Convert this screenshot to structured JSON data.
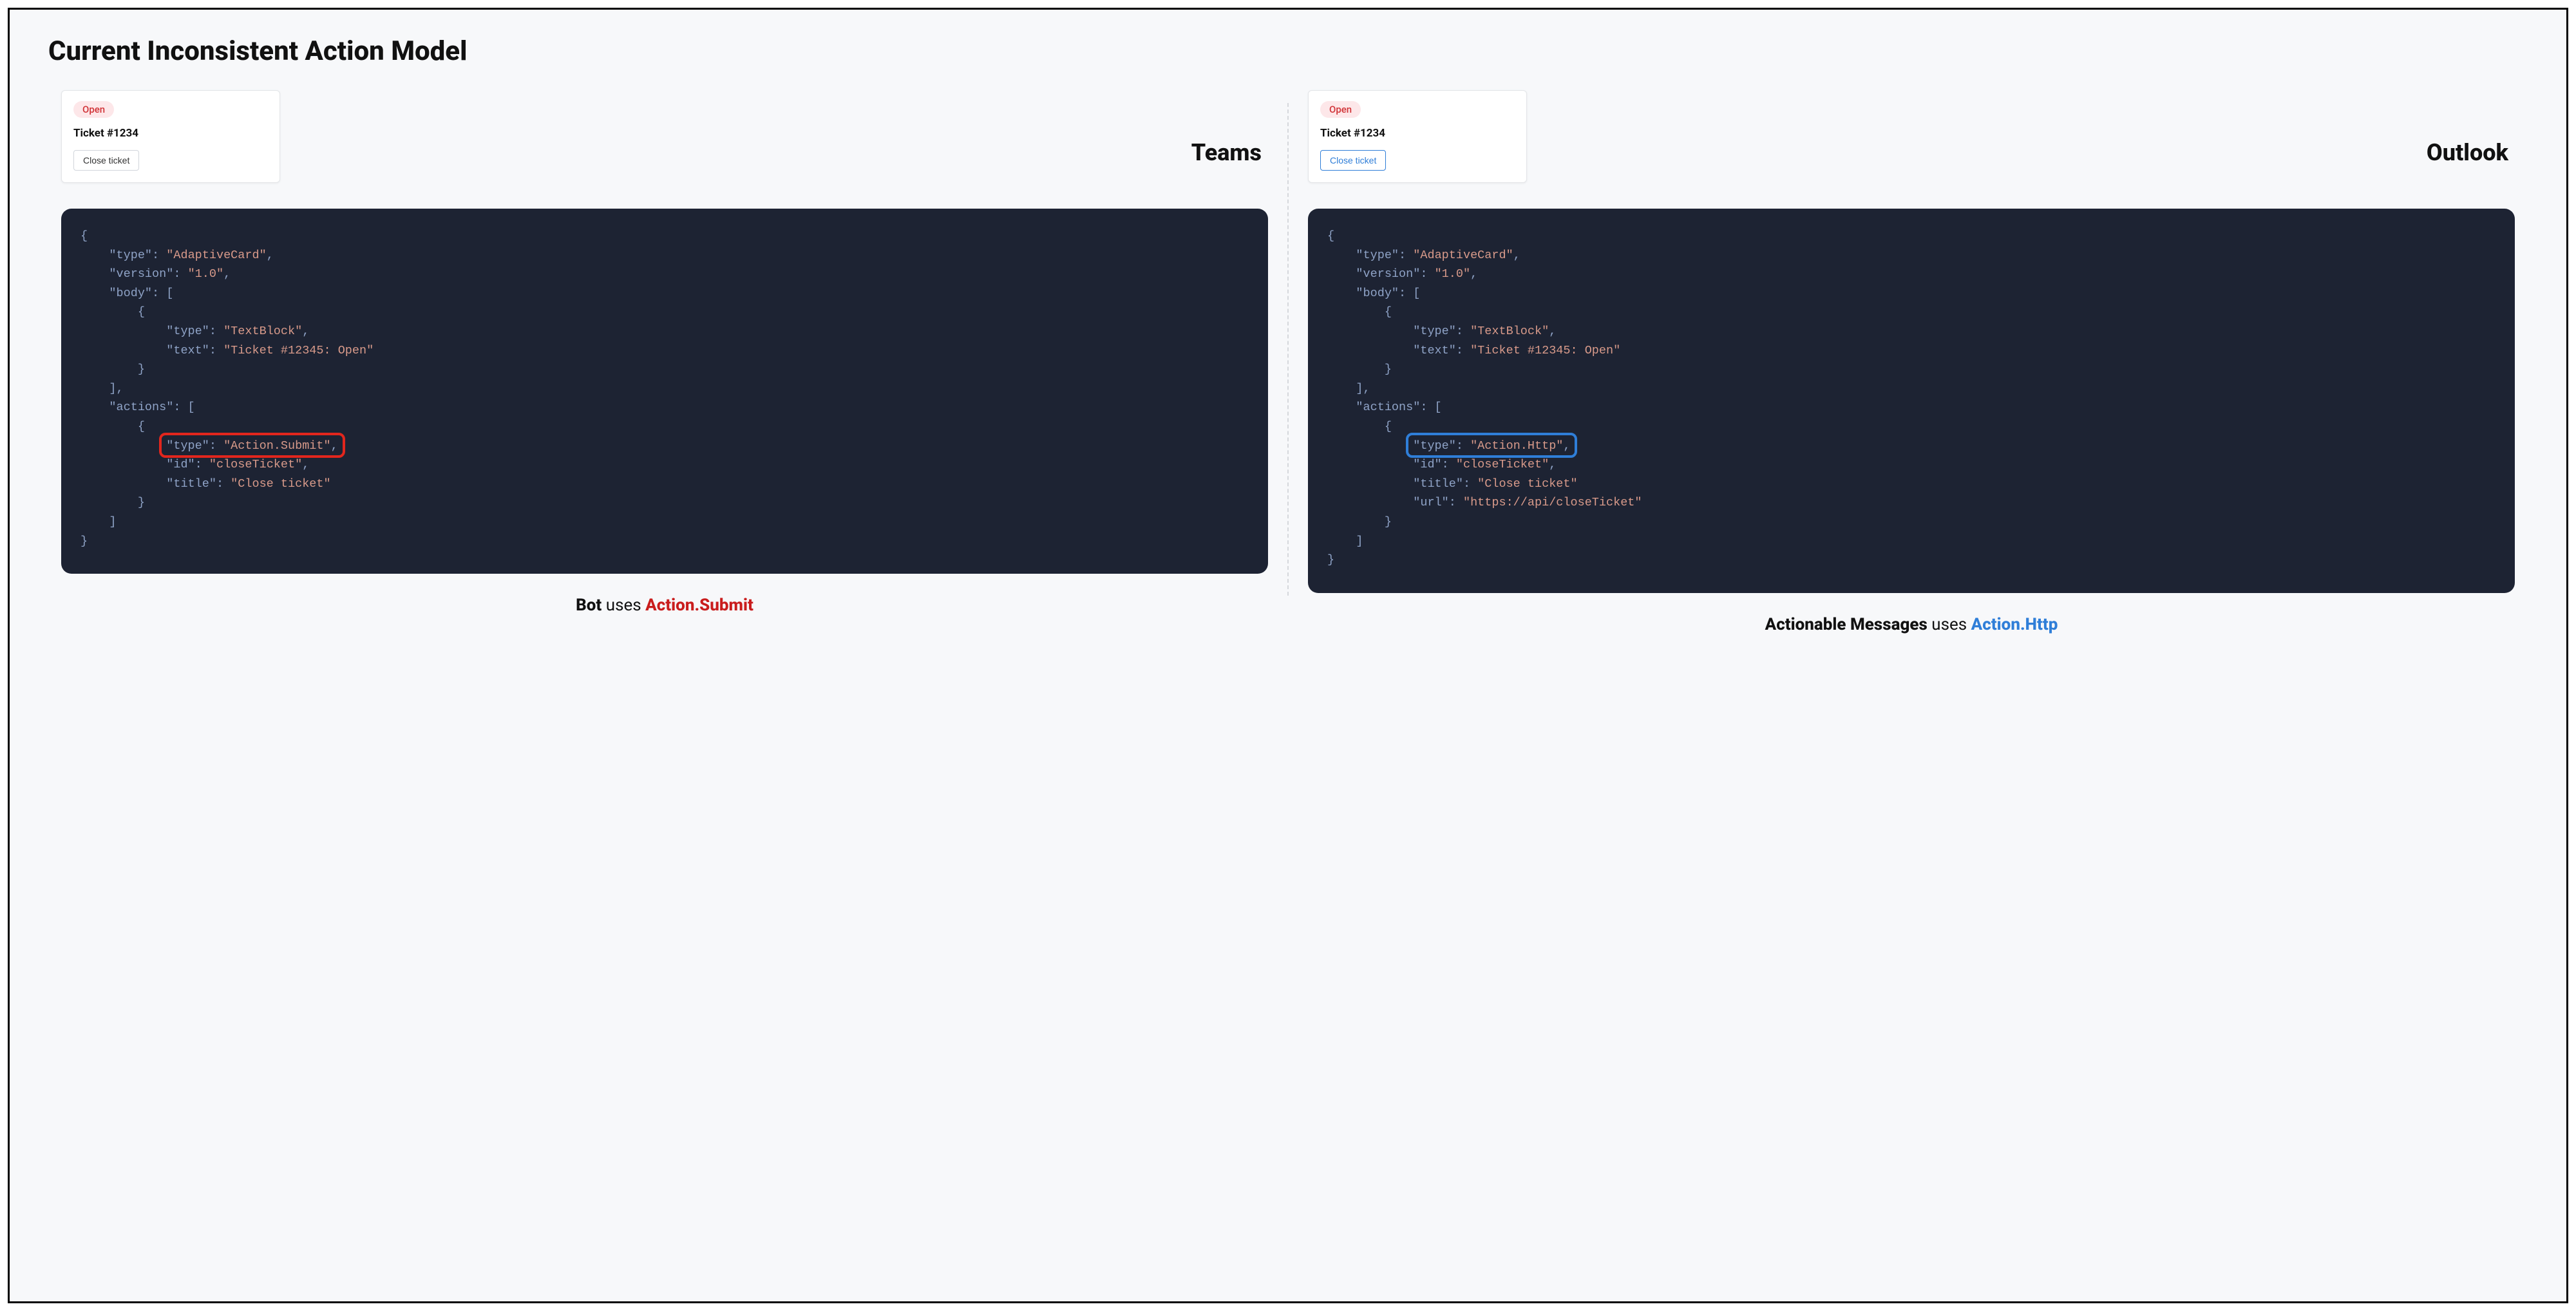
{
  "title": "Current Inconsistent Action Model",
  "colors": {
    "red": "#e2261d",
    "blue": "#2f7ed8",
    "badge_bg": "#fde7e9",
    "badge_fg": "#d13438",
    "code_bg": "#1d2333"
  },
  "left": {
    "platform": "Teams",
    "card": {
      "badge": "Open",
      "title": "Ticket #1234",
      "button": "Close ticket",
      "button_style": "teams"
    },
    "code": {
      "lines": [
        {
          "indent": 0,
          "raw": "{"
        },
        {
          "indent": 1,
          "key": "type",
          "val": "AdaptiveCard",
          "comma": true
        },
        {
          "indent": 1,
          "key": "version",
          "val": "1.0",
          "comma": true
        },
        {
          "indent": 1,
          "key": "body",
          "open": "[",
          "comma": false
        },
        {
          "indent": 2,
          "raw": "{"
        },
        {
          "indent": 3,
          "key": "type",
          "val": "TextBlock",
          "comma": true
        },
        {
          "indent": 3,
          "key": "text",
          "val": "Ticket #12345: Open"
        },
        {
          "indent": 2,
          "raw": "}"
        },
        {
          "indent": 1,
          "raw": "],"
        },
        {
          "indent": 1,
          "key": "actions",
          "open": "[",
          "comma": false
        },
        {
          "indent": 2,
          "raw": "{"
        },
        {
          "indent": 3,
          "key": "type",
          "val": "Action.Submit",
          "comma": true,
          "highlight": true
        },
        {
          "indent": 3,
          "key": "id",
          "val": "closeTicket",
          "comma": true
        },
        {
          "indent": 3,
          "key": "title",
          "val": "Close ticket"
        },
        {
          "indent": 2,
          "raw": "}"
        },
        {
          "indent": 1,
          "raw": "]"
        },
        {
          "indent": 0,
          "raw": "}"
        }
      ],
      "highlight_color": "red"
    },
    "caption": {
      "prefix_bold": "Bot",
      "middle": " uses ",
      "suffix_colored": "Action.Submit",
      "color": "red"
    }
  },
  "right": {
    "platform": "Outlook",
    "card": {
      "badge": "Open",
      "title": "Ticket #1234",
      "button": "Close ticket",
      "button_style": "outlook"
    },
    "code": {
      "lines": [
        {
          "indent": 0,
          "raw": "{"
        },
        {
          "indent": 1,
          "key": "type",
          "val": "AdaptiveCard",
          "comma": true
        },
        {
          "indent": 1,
          "key": "version",
          "val": "1.0",
          "comma": true
        },
        {
          "indent": 1,
          "key": "body",
          "open": "[",
          "comma": false
        },
        {
          "indent": 2,
          "raw": "{"
        },
        {
          "indent": 3,
          "key": "type",
          "val": "TextBlock",
          "comma": true
        },
        {
          "indent": 3,
          "key": "text",
          "val": "Ticket #12345: Open"
        },
        {
          "indent": 2,
          "raw": "}"
        },
        {
          "indent": 1,
          "raw": "],"
        },
        {
          "indent": 1,
          "key": "actions",
          "open": "[",
          "comma": false
        },
        {
          "indent": 2,
          "raw": "{"
        },
        {
          "indent": 3,
          "key": "type",
          "val": "Action.Http",
          "comma": true,
          "highlight": true
        },
        {
          "indent": 3,
          "key": "id",
          "val": "closeTicket",
          "comma": true
        },
        {
          "indent": 3,
          "key": "title",
          "val": "Close ticket"
        },
        {
          "indent": 3,
          "key": "url",
          "val": "https://api/closeTicket"
        },
        {
          "indent": 2,
          "raw": "}"
        },
        {
          "indent": 1,
          "raw": "]"
        },
        {
          "indent": 0,
          "raw": "}"
        }
      ],
      "highlight_color": "blue"
    },
    "caption": {
      "prefix_bold": "Actionable Messages",
      "middle": " uses ",
      "suffix_colored": "Action.Http",
      "color": "blue"
    }
  }
}
